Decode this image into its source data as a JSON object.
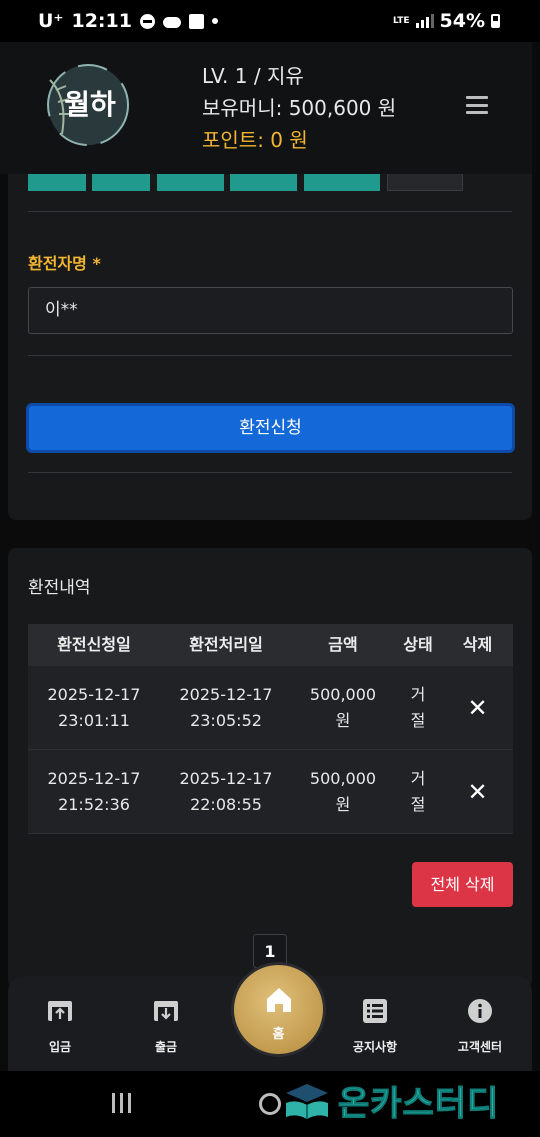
{
  "status_bar": {
    "carrier": "U⁺",
    "time": "12:11",
    "network": "LTE",
    "battery": "54%"
  },
  "header": {
    "logo_text": "월하",
    "level": "LV. 1 / 지유",
    "money": "보유머니: 500,600 원",
    "points": "포인트: 0 원"
  },
  "form": {
    "depositor_label": "환전자명 *",
    "depositor_value": "이**",
    "submit_label": "환전신청"
  },
  "history": {
    "title": "환전내역",
    "columns": [
      "환전신청일",
      "환전처리일",
      "금액",
      "상태",
      "삭제"
    ],
    "rows": [
      {
        "request_date": "2025-12-17",
        "request_time": "23:01:11",
        "process_date": "2025-12-17",
        "process_time": "23:05:52",
        "amount": "500,000",
        "unit": "원",
        "status_1": "거",
        "status_2": "절",
        "delete": "✕"
      },
      {
        "request_date": "2025-12-17",
        "request_time": "21:52:36",
        "process_date": "2025-12-17",
        "process_time": "22:08:55",
        "amount": "500,000",
        "unit": "원",
        "status_1": "거",
        "status_2": "절",
        "delete": "✕"
      }
    ],
    "delete_all_label": "전체 삭제",
    "page": "1"
  },
  "bottom_nav": {
    "deposit": "입금",
    "withdraw": "출금",
    "home": "홈",
    "notice": "공지사항",
    "support": "고객센터"
  },
  "watermark": "온카스터디",
  "colors": {
    "accent_gold": "#f2b531",
    "primary_blue": "#1468d8",
    "danger_red": "#dc3545",
    "teal": "#1f9a8c"
  }
}
